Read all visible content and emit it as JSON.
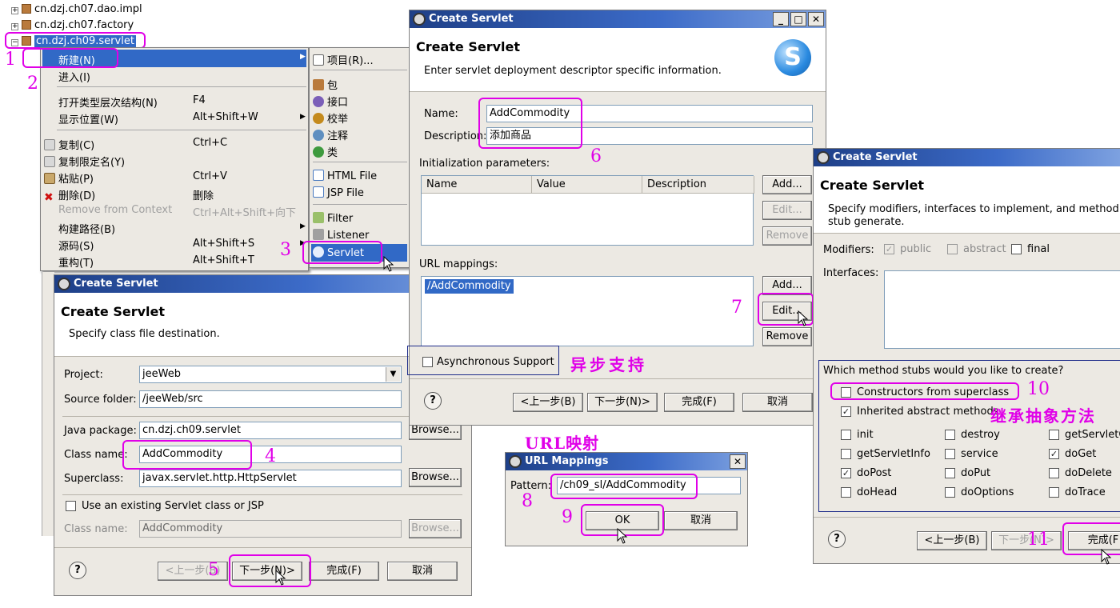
{
  "tree": {
    "items": [
      "cn.dzj.ch07.dao.impl",
      "cn.dzj.ch07.factory",
      "cn.dzj.ch09.servlet"
    ]
  },
  "context_menu": {
    "items": [
      {
        "label": "新建(N)",
        "shortcut": ""
      },
      {
        "label": "进入(I)",
        "shortcut": ""
      },
      {
        "label": "打开类型层次结构(N)",
        "shortcut": "F4"
      },
      {
        "label": "显示位置(W)",
        "shortcut": "Alt+Shift+W"
      },
      {
        "label": "复制(C)",
        "shortcut": "Ctrl+C"
      },
      {
        "label": "复制限定名(Y)",
        "shortcut": ""
      },
      {
        "label": "粘贴(P)",
        "shortcut": "Ctrl+V"
      },
      {
        "label": "删除(D)",
        "shortcut": "删除"
      },
      {
        "label": "Remove from Context",
        "shortcut": "Ctrl+Alt+Shift+向下"
      },
      {
        "label": "构建路径(B)",
        "shortcut": ""
      },
      {
        "label": "源码(S)",
        "shortcut": "Alt+Shift+S"
      },
      {
        "label": "重构(T)",
        "shortcut": "Alt+Shift+T"
      }
    ]
  },
  "submenu": {
    "items": [
      "项目(R)...",
      "包",
      "接口",
      "校举",
      "注释",
      "类",
      "HTML File",
      "JSP File",
      "Filter",
      "Listener",
      "Servlet"
    ]
  },
  "dialog1": {
    "title": "Create Servlet",
    "header_title": "Create Servlet",
    "header_sub": "Specify class file destination.",
    "project_label": "Project:",
    "project_value": "jeeWeb",
    "source_label": "Source folder:",
    "source_value": "/jeeWeb/src",
    "package_label": "Java package:",
    "package_value": "cn.dzj.ch09.servlet",
    "class_label": "Class name:",
    "class_value": "AddCommodity",
    "super_label": "Superclass:",
    "super_value": "javax.servlet.http.HttpServlet",
    "browse": "Browse...",
    "existing_label": "Use an existing Servlet class or JSP",
    "class2_label": "Class name:",
    "class2_value": "AddCommodity",
    "back": "<上一步(B)",
    "next": "下一步(N)>",
    "finish": "完成(F)",
    "cancel": "取消"
  },
  "dialog2": {
    "title": "Create Servlet",
    "header_title": "Create Servlet",
    "header_sub": "Enter servlet deployment descriptor specific information.",
    "name_label": "Name:",
    "name_value": "AddCommodity",
    "desc_label": "Description:",
    "desc_value": "添加商品",
    "init_label": "Initialization parameters:",
    "col_name": "Name",
    "col_value": "Value",
    "col_desc": "Description",
    "add": "Add...",
    "edit": "Edit...",
    "remove": "Remove",
    "url_label": "URL mappings:",
    "url_item": "/AddCommodity",
    "async_label": "Asynchronous Support",
    "back": "<上一步(B)",
    "next": "下一步(N)>",
    "finish": "完成(F)",
    "cancel": "取消"
  },
  "dialog3": {
    "title": "Create Servlet",
    "header_title": "Create Servlet",
    "header_sub": "Specify modifiers, interfaces to implement, and method stub generate.",
    "modifiers_label": "Modifiers:",
    "public": "public",
    "abstract": "abstract",
    "final": "final",
    "interfaces_label": "Interfaces:",
    "stubs_label": "Which method stubs would you like to create?",
    "constructors": "Constructors from superclass",
    "inherited": "Inherited abstract methods",
    "methods": [
      {
        "label": "init",
        "checked": false
      },
      {
        "label": "destroy",
        "checked": false
      },
      {
        "label": "getServletC",
        "checked": false
      },
      {
        "label": "getServletInfo",
        "checked": false
      },
      {
        "label": "service",
        "checked": false
      },
      {
        "label": "doGet",
        "checked": true
      },
      {
        "label": "doPost",
        "checked": true
      },
      {
        "label": "doPut",
        "checked": false
      },
      {
        "label": "doDelete",
        "checked": false
      },
      {
        "label": "doHead",
        "checked": false
      },
      {
        "label": "doOptions",
        "checked": false
      },
      {
        "label": "doTrace",
        "checked": false
      }
    ],
    "back": "<上一步(B)",
    "next": "下一步(N)>",
    "finish": "完成(F"
  },
  "dialog4": {
    "title": "URL Mappings",
    "pattern_label": "Pattern:",
    "pattern_value": "/ch09_sl/AddCommodity",
    "ok": "OK",
    "cancel": "取消"
  },
  "annotations": {
    "n1": "1",
    "n2": "2",
    "n3": "3",
    "n4": "4",
    "n5": "5",
    "n6": "6",
    "n7": "7",
    "n8": "8",
    "n9": "9",
    "n10": "10",
    "n11": "11",
    "async_cn": "异步支持",
    "url_cn": "URL映射",
    "inherit_cn": "继承抽象方法"
  },
  "colors": {
    "annotation": "#e000e8",
    "selection": "#3169c6",
    "titlebar": "#1e3f87"
  }
}
